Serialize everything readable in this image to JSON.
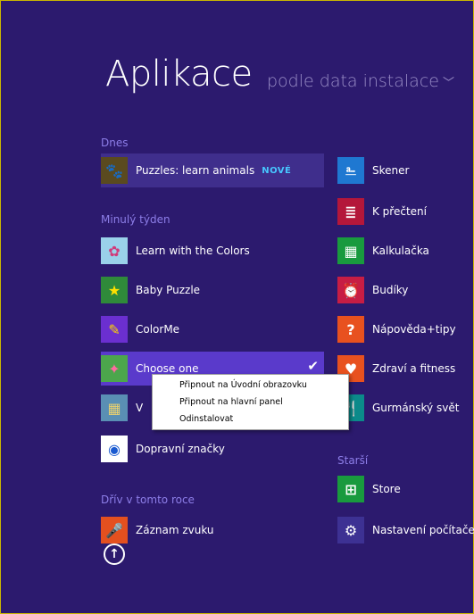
{
  "header": {
    "title": "Aplikace",
    "sort_label": "podle data instalace",
    "sort_chevron": "﹀"
  },
  "groups": {
    "today": "Dnes",
    "last_week": "Minulý týden",
    "earlier_year": "Dřív v tomto roce",
    "older": "Starší"
  },
  "left_column": [
    {
      "label": "Puzzles: learn animals",
      "badge": "NOVÉ",
      "icon": "puzzle-animals-icon"
    },
    {
      "label": "Learn with the Colors",
      "icon": "colors-icon"
    },
    {
      "label": "Baby Puzzle",
      "icon": "star-puzzle-icon"
    },
    {
      "label": "ColorMe",
      "icon": "colorme-icon"
    },
    {
      "label": "Choose one",
      "icon": "choose-one-icon"
    },
    {
      "label": "V",
      "icon": "app-icon"
    },
    {
      "label": "Dopravní značky",
      "icon": "traffic-sign-icon"
    },
    {
      "label": "Záznam zvuku",
      "icon": "microphone-icon"
    }
  ],
  "right_column": [
    {
      "label": "Skener",
      "icon": "scanner-icon",
      "color": "#1f78d1"
    },
    {
      "label": "K přečtení",
      "icon": "reading-list-icon",
      "color": "#b4173a"
    },
    {
      "label": "Kalkulačka",
      "icon": "calculator-icon",
      "color": "#199a3e"
    },
    {
      "label": "Budíky",
      "icon": "alarm-icon",
      "color": "#c71d44"
    },
    {
      "label": "Nápověda+tipy",
      "icon": "help-icon",
      "color": "#e8511f"
    },
    {
      "label": "Zdraví a fitness",
      "icon": "heart-icon",
      "color": "#e8511f"
    },
    {
      "label": "Gurmánský svět",
      "icon": "food-icon",
      "color": "#0b8a8a"
    },
    {
      "label": "Store",
      "icon": "store-icon",
      "color": "#199a3e"
    },
    {
      "label": "Nastavení počítače",
      "icon": "settings-icon",
      "color": "#3d3193"
    }
  ],
  "context_menu": {
    "pin_start": "Připnout na Úvodní obrazovku",
    "pin_taskbar": "Připnout na hlavní panel",
    "uninstall": "Odinstalovat"
  },
  "colors": {
    "background": "#2c1a6e",
    "group_label": "#8d7ee8",
    "accent": "#5a3acb"
  }
}
